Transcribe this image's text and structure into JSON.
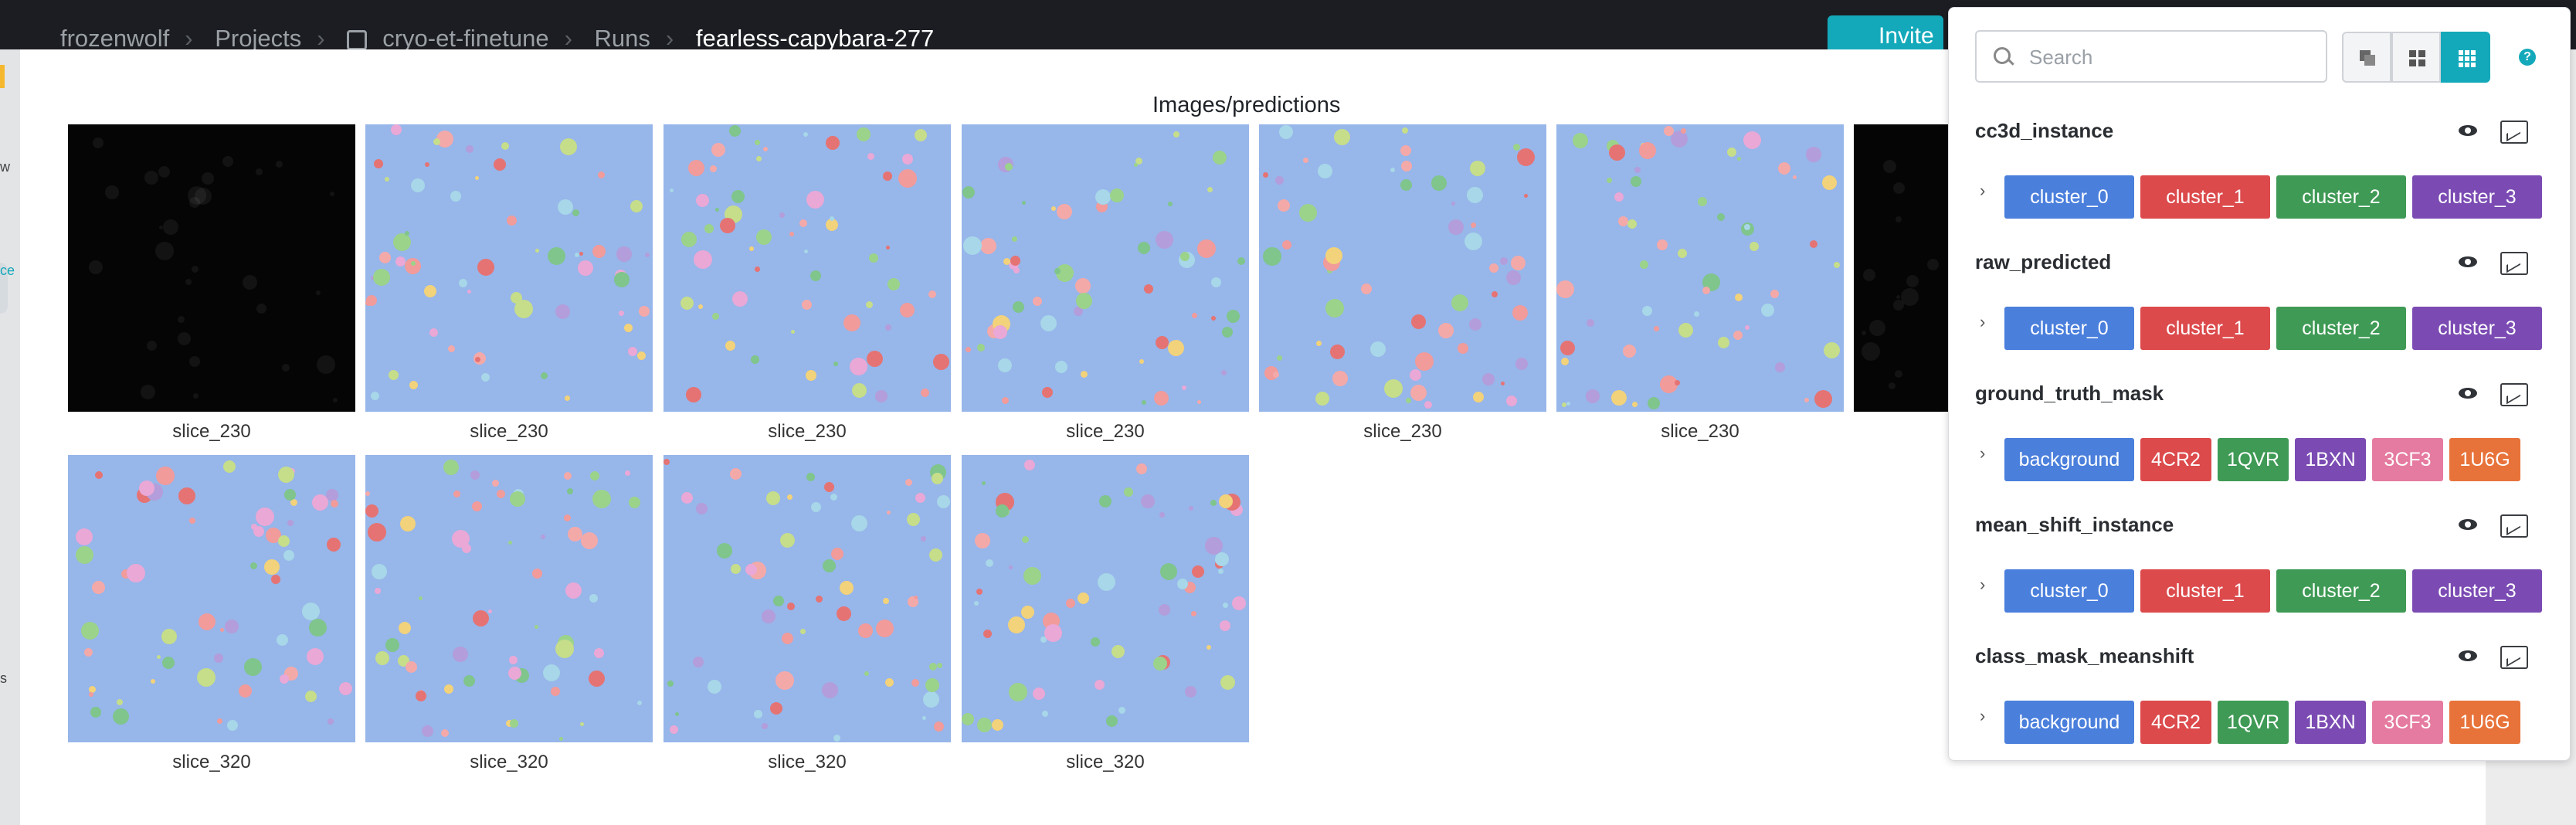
{
  "breadcrumb": {
    "items": [
      "frozenwolf",
      "Projects",
      "cryo-et-finetune",
      "Runs",
      "fearless-capybara-277"
    ]
  },
  "header": {
    "invite_label": "Invite"
  },
  "left_nav": {
    "label_1": "w",
    "label_2": "ce",
    "label_3": "s"
  },
  "panel": {
    "title": "Images/predictions"
  },
  "images": {
    "row1_captions": [
      "slice_230",
      "slice_230",
      "slice_230",
      "slice_230",
      "slice_230",
      "slice_230"
    ],
    "row2_captions": [
      "slice_320",
      "slice_320",
      "slice_320",
      "slice_320"
    ]
  },
  "controls": {
    "search_placeholder": "Search",
    "view_modes": [
      "stack",
      "grid-small",
      "grid-large"
    ],
    "active_view": "grid-large",
    "help_label": "?"
  },
  "mask_sections": [
    {
      "name": "cc3d_instance",
      "chips": [
        "cluster_0",
        "cluster_1",
        "cluster_2",
        "cluster_3"
      ]
    },
    {
      "name": "raw_predicted",
      "chips": [
        "cluster_0",
        "cluster_1",
        "cluster_2",
        "cluster_3"
      ]
    },
    {
      "name": "ground_truth_mask",
      "chips": [
        "background",
        "4CR2",
        "1QVR",
        "1BXN",
        "3CF3",
        "1U6G"
      ]
    },
    {
      "name": "mean_shift_instance",
      "chips": [
        "cluster_0",
        "cluster_1",
        "cluster_2",
        "cluster_3"
      ]
    },
    {
      "name": "class_mask_meanshift",
      "chips": [
        "background",
        "4CR2",
        "1QVR",
        "1BXN",
        "3CF3",
        "1U6G"
      ]
    }
  ],
  "colors": {
    "accent": "#13a9ba",
    "chip_blue": "#4a7fdc",
    "chip_red": "#dc4a4c",
    "chip_green": "#3f9a55",
    "chip_purple": "#7b4bb3",
    "chip_pink": "#e57ba0",
    "chip_orange": "#e8733a",
    "tile_background": "#97b6ea"
  }
}
